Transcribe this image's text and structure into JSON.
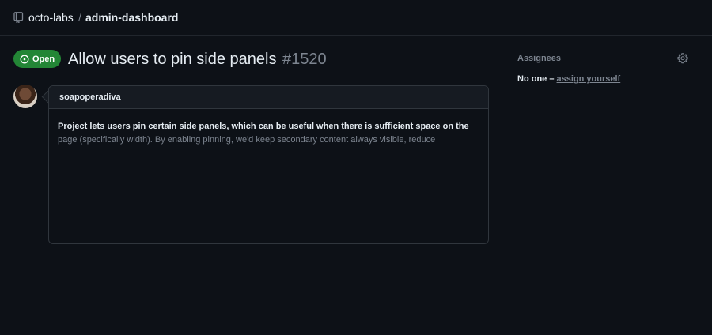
{
  "header": {
    "owner": "octo-labs",
    "separator": "/",
    "repo": "admin-dashboard"
  },
  "issue": {
    "status": "Open",
    "title": "Allow users to pin side panels",
    "number": "#1520"
  },
  "comment": {
    "author": "soapoperadiva",
    "body_line_1": "Project lets users pin certain side panels, which can be useful when there is sufficient space on the",
    "body_line_2": "page (specifically width). By enabling pinning, we'd keep secondary content always visible, reduce"
  },
  "sidebar": {
    "assignees_heading": "Assignees",
    "no_one_text": "No one –",
    "assign_yourself": "assign yourself"
  },
  "colors": {
    "background": "#0d1117",
    "open_badge": "#238636",
    "muted_text": "#7d8590",
    "border": "#30363d"
  },
  "icons": {
    "repo": "repo-icon",
    "status": "issue-opened-icon",
    "settings": "gear-icon"
  }
}
